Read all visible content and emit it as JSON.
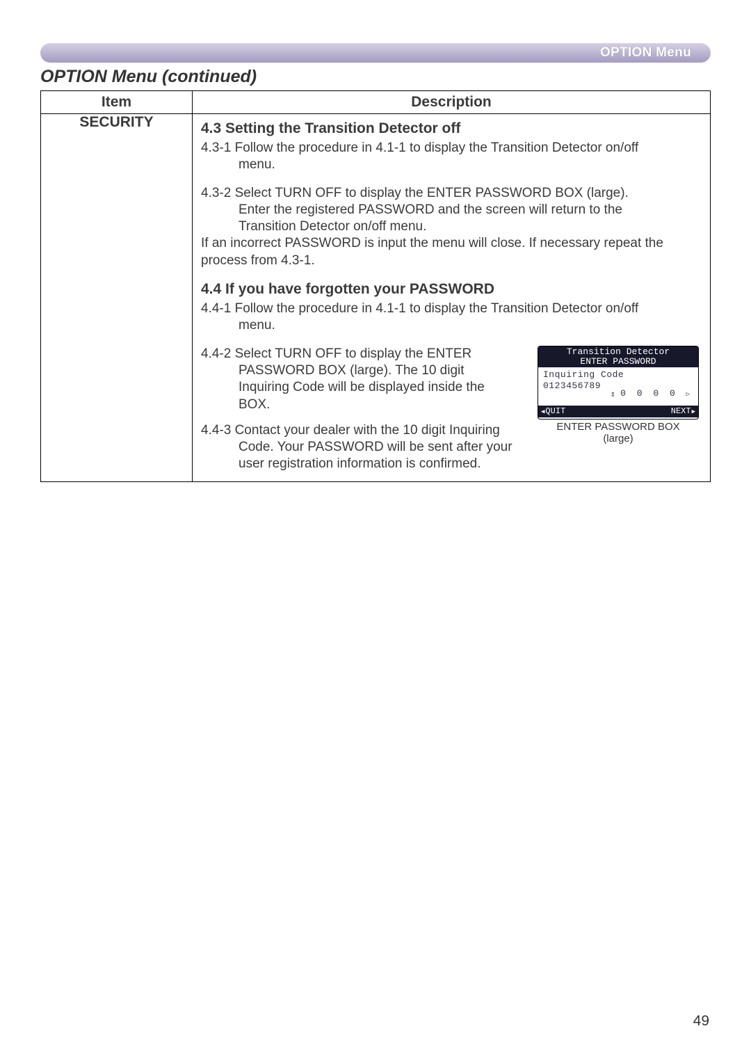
{
  "banner": {
    "label": "OPTION Menu"
  },
  "page": {
    "title": "OPTION Menu (continued)",
    "number": "49"
  },
  "table": {
    "headers": {
      "item": "Item",
      "desc": "Description"
    },
    "row": {
      "item": "SECURITY",
      "sec43": {
        "head": "4.3 Setting the Transition Detector off",
        "s1": "4.3-1 Follow the procedure in 4.1-1 to display the Transition Detector on/off menu.",
        "s2a": "4.3-2 Select TURN OFF to display the ENTER PASSWORD BOX (large). Enter the registered PASSWORD and the screen will return to the Transition Detector on/off menu.",
        "s2b": "If an incorrect PASSWORD is input the menu will close. If necessary repeat the process from 4.3-1."
      },
      "sec44": {
        "head": "4.4 If you have forgotten your PASSWORD",
        "s1": "4.4-1 Follow the procedure in 4.1-1 to display the Transition Detector on/off menu.",
        "s2": "4.4-2 Select TURN OFF to display the ENTER PASSWORD BOX (large). The 10 digit Inquiring Code will be displayed inside the BOX.",
        "s3": "4.4-3 Contact your dealer with the 10 digit Inquiring Code. Your PASSWORD will be sent after your user registration information is confirmed."
      }
    }
  },
  "dialog": {
    "title1": "Transition Detector",
    "title2": "ENTER PASSWORD",
    "inq_label": "Inquiring Code",
    "inq_code": "0123456789",
    "digits": "0  0  0  0",
    "quit": "QUIT",
    "next": "NEXT",
    "caption1": "ENTER PASSWORD BOX",
    "caption2": "(large)"
  }
}
